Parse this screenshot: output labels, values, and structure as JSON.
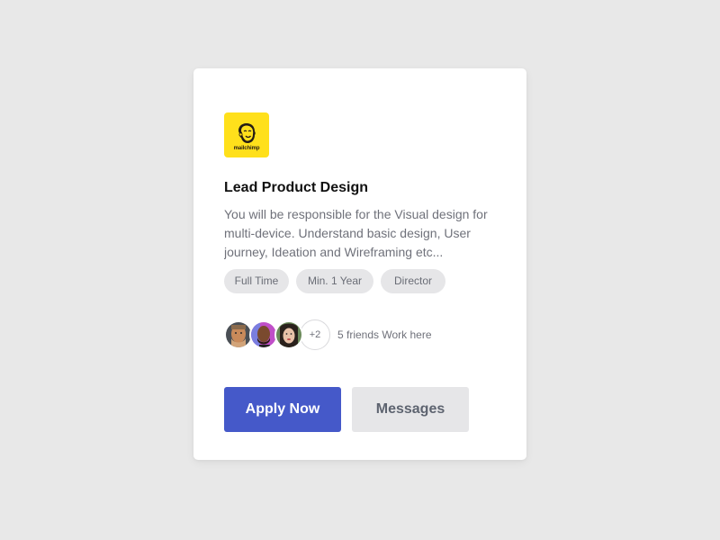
{
  "job": {
    "company_logo_text": "mailchimp",
    "title": "Lead Product Design",
    "description": "You will be responsible for the Visual design for multi-device. Understand basic design, User journey, Ideation and Wireframing etc...",
    "tags": [
      "Full Time",
      "Min. 1 Year",
      "Director"
    ]
  },
  "friends": {
    "more_count": "+2",
    "text": "5 friends Work here"
  },
  "actions": {
    "apply_label": "Apply Now",
    "messages_label": "Messages"
  },
  "colors": {
    "brand_yellow": "#ffe01b",
    "primary": "#4559c9",
    "secondary_bg": "#e6e6e8"
  }
}
